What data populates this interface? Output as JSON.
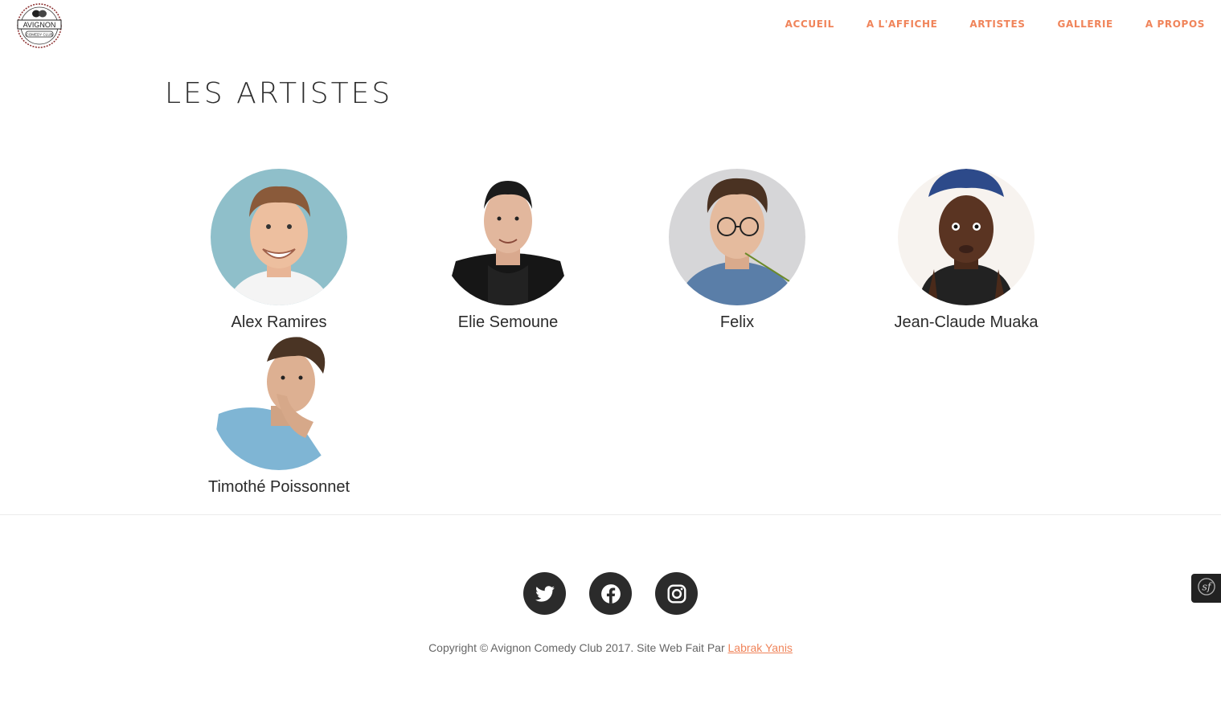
{
  "header": {
    "logo": {
      "text": "AVIGNON",
      "subtext": "COMEDY CLUB"
    },
    "nav": [
      {
        "label": "ACCUEIL"
      },
      {
        "label": "A L'AFFICHE"
      },
      {
        "label": "ARTISTES"
      },
      {
        "label": "GALLERIE"
      },
      {
        "label": "A PROPOS"
      }
    ]
  },
  "page": {
    "title": "LES ARTISTES"
  },
  "artists": [
    {
      "name": "Alex Ramires"
    },
    {
      "name": "Elie Semoune"
    },
    {
      "name": "Felix"
    },
    {
      "name": "Jean-Claude Muaka"
    },
    {
      "name": "Timothé Poissonnet"
    }
  ],
  "footer": {
    "socials": [
      {
        "icon": "twitter-icon"
      },
      {
        "icon": "facebook-icon"
      },
      {
        "icon": "instagram-icon"
      }
    ],
    "copyright_text": "Copyright © Avignon Comedy Club 2017. Site Web Fait Par ",
    "author_link": "Labrak Yanis"
  },
  "colors": {
    "accent": "#f0845a",
    "dark": "#2b2b2b"
  }
}
